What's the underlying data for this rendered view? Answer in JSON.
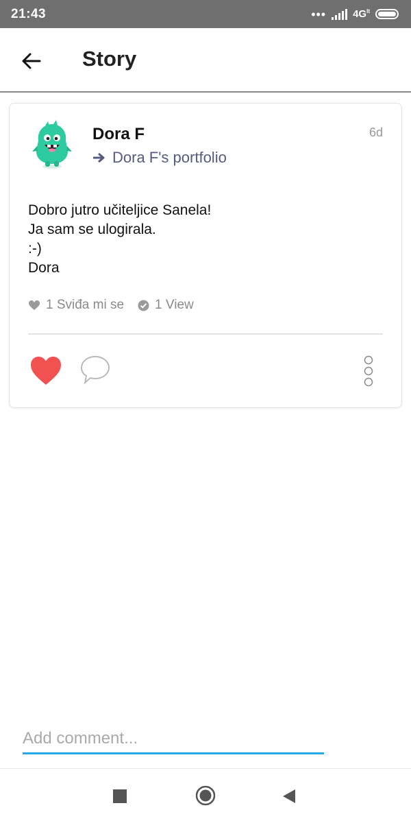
{
  "status_bar": {
    "time": "21:43",
    "dots": "•••",
    "network": "4G",
    "network_sub": "lt"
  },
  "header": {
    "title": "Story",
    "back_icon": "arrow-left-icon"
  },
  "story": {
    "author": "Dora F",
    "age": "6d",
    "portfolio_link": "Dora F's portfolio",
    "message_lines": [
      "Dobro jutro učiteljice Sanela!",
      "Ja sam se ulogirala.",
      ":-)",
      "Dora"
    ],
    "likes": "1 Sviđa mi se",
    "views": "1 View",
    "avatar_icon": "green-monster-avatar",
    "liked": true
  },
  "comment": {
    "placeholder": "Add comment..."
  },
  "colors": {
    "accent_blue": "#29a6e6",
    "heart_red": "#f25151",
    "link_purple": "#565a80",
    "monster_green": "#2ecba0"
  }
}
